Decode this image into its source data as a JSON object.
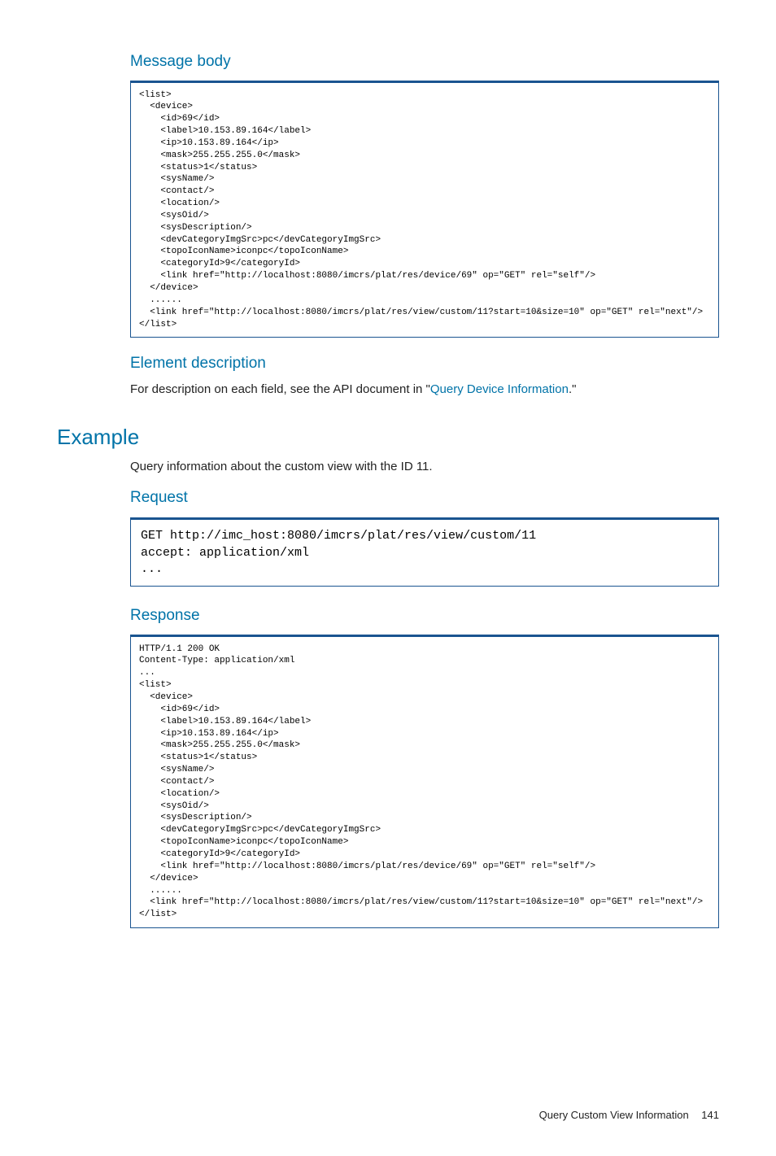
{
  "sections": {
    "message_body": {
      "title": "Message body",
      "code": "<list>\n  <device>\n    <id>69</id>\n    <label>10.153.89.164</label>\n    <ip>10.153.89.164</ip>\n    <mask>255.255.255.0</mask>\n    <status>1</status>\n    <sysName/>\n    <contact/>\n    <location/>\n    <sysOid/>\n    <sysDescription/>\n    <devCategoryImgSrc>pc</devCategoryImgSrc>\n    <topoIconName>iconpc</topoIconName>\n    <categoryId>9</categoryId>\n    <link href=\"http://localhost:8080/imcrs/plat/res/device/69\" op=\"GET\" rel=\"self\"/>\n  </device>\n  ......\n  <link href=\"http://localhost:8080/imcrs/plat/res/view/custom/11?start=10&size=10\" op=\"GET\" rel=\"next\"/>\n</list>"
    },
    "element_description": {
      "title": "Element description",
      "text_before": "For description on each field, see the API document in \"",
      "link_text": "Query Device Information",
      "text_after": ".\""
    },
    "example": {
      "title": "Example",
      "intro": "Query information about the custom view with the ID 11."
    },
    "request": {
      "title": "Request",
      "code": "GET http://imc_host:8080/imcrs/plat/res/view/custom/11\naccept: application/xml\n..."
    },
    "response": {
      "title": "Response",
      "code": "HTTP/1.1 200 OK\nContent-Type: application/xml\n...\n<list>\n  <device>\n    <id>69</id>\n    <label>10.153.89.164</label>\n    <ip>10.153.89.164</ip>\n    <mask>255.255.255.0</mask>\n    <status>1</status>\n    <sysName/>\n    <contact/>\n    <location/>\n    <sysOid/>\n    <sysDescription/>\n    <devCategoryImgSrc>pc</devCategoryImgSrc>\n    <topoIconName>iconpc</topoIconName>\n    <categoryId>9</categoryId>\n    <link href=\"http://localhost:8080/imcrs/plat/res/device/69\" op=\"GET\" rel=\"self\"/>\n  </device>\n  ......\n  <link href=\"http://localhost:8080/imcrs/plat/res/view/custom/11?start=10&size=10\" op=\"GET\" rel=\"next\"/>\n</list>"
    }
  },
  "footer": {
    "title": "Query Custom View Information",
    "page": "141"
  }
}
